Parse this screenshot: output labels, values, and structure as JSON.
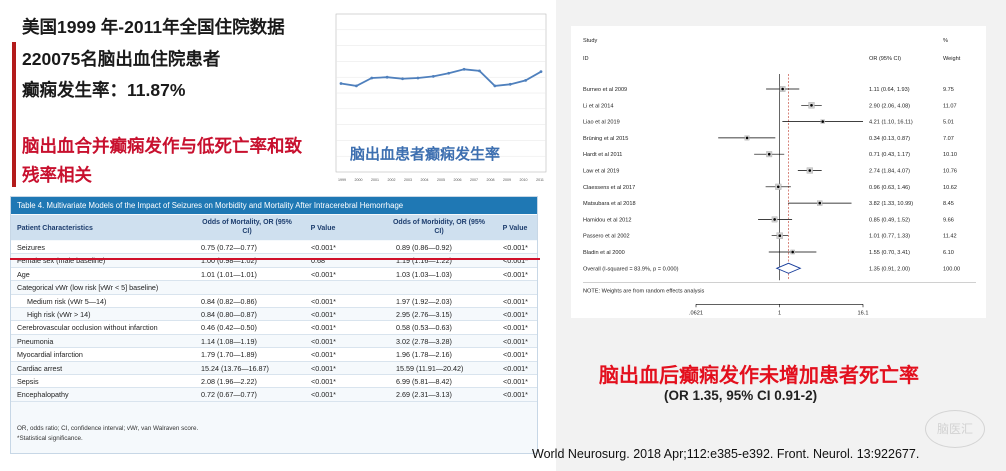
{
  "headline": {
    "line1": "美国1999 年-2011年全国住院数据",
    "line2": "220075名脑出血住院患者",
    "line3": "癫痫发生率：11.87%",
    "red1": "脑出血合并癫痫发作与低死亡率和致",
    "red2": "残率相关"
  },
  "chart_data": [
    {
      "type": "line",
      "caption": "脑出血患者癫痫发生率",
      "x": [
        "1999",
        "2000",
        "2001",
        "2002",
        "2003",
        "2004",
        "2005",
        "2006",
        "2007",
        "2008",
        "2009",
        "2010",
        "2011"
      ],
      "series": [
        {
          "values": [
            11.2,
            10.9,
            11.9,
            12.0,
            11.8,
            11.9,
            12.1,
            12.5,
            13.0,
            12.8,
            10.9,
            11.1,
            11.6,
            12.7
          ]
        }
      ],
      "ylim": [
        0,
        20
      ],
      "grid": true
    },
    {
      "type": "table",
      "title": "Table 4.  Multivariate Models of the Impact of Seizures on Morbidity and Mortality After Intracerebral Hemorrhage",
      "columns": [
        "Patient Characteristics",
        "Odds of Mortality, OR (95% CI)",
        "P Value",
        "Odds of Morbidity, OR (95% CI)",
        "P Value"
      ],
      "rows": [
        [
          "Seizures",
          "0.75 (0.72—0.77)",
          "<0.001*",
          "0.89 (0.86—0.92)",
          "<0.001*"
        ],
        [
          "Female sex (male baseline)",
          "1.00 (0.98—1.02)",
          "0.68",
          "1.19 (1.16—1.22)",
          "<0.001*"
        ],
        [
          "Age",
          "1.01 (1.01—1.01)",
          "<0.001*",
          "1.03 (1.03—1.03)",
          "<0.001*"
        ],
        [
          "Categorical vWr (low risk [vWr < 5] baseline)",
          "",
          "",
          "",
          ""
        ],
        [
          "Medium risk (vWr 5—14)",
          "0.84 (0.82—0.86)",
          "<0.001*",
          "1.97 (1.92—2.03)",
          "<0.001*"
        ],
        [
          "High risk (vWr > 14)",
          "0.84 (0.80—0.87)",
          "<0.001*",
          "2.95 (2.76—3.15)",
          "<0.001*"
        ],
        [
          "Cerebrovascular occlusion without infarction",
          "0.46 (0.42—0.50)",
          "<0.001*",
          "0.58 (0.53—0.63)",
          "<0.001*"
        ],
        [
          "Pneumonia",
          "1.14 (1.08—1.19)",
          "<0.001*",
          "3.02 (2.78—3.28)",
          "<0.001*"
        ],
        [
          "Myocardial infarction",
          "1.79 (1.70—1.89)",
          "<0.001*",
          "1.96 (1.78—2.16)",
          "<0.001*"
        ],
        [
          "Cardiac arrest",
          "15.24 (13.76—16.87)",
          "<0.001*",
          "15.59 (11.91—20.42)",
          "<0.001*"
        ],
        [
          "Sepsis",
          "2.08 (1.96—2.22)",
          "<0.001*",
          "6.99 (5.81—8.42)",
          "<0.001*"
        ],
        [
          "Encephalopathy",
          "0.72 (0.67—0.77)",
          "<0.001*",
          "2.69 (2.31—3.13)",
          "<0.001*"
        ]
      ],
      "footnotes": [
        "OR, odds ratio; CI, confidence interval; vWr, van Walraven score.",
        "*Statistical significance."
      ]
    },
    {
      "type": "scatter",
      "subtype": "forest",
      "header": {
        "study": "Study",
        "id": "ID",
        "or": "OR (95% CI)",
        "pct": "%",
        "weight": "Weight"
      },
      "studies": [
        {
          "name": "Burneo et al 2009",
          "or": 1.11,
          "lo": 0.64,
          "hi": 1.93,
          "label": "1.11 (0.64, 1.93)",
          "weight": "9.75"
        },
        {
          "name": "Li et al 2014",
          "or": 2.9,
          "lo": 2.06,
          "hi": 4.08,
          "label": "2.90 (2.06, 4.08)",
          "weight": "11.07"
        },
        {
          "name": "Liao et al 2019",
          "or": 4.21,
          "lo": 1.1,
          "hi": 16.11,
          "label": "4.21 (1.10, 16.11)",
          "weight": "5.01"
        },
        {
          "name": "Brüning et al 2015",
          "or": 0.34,
          "lo": 0.13,
          "hi": 0.87,
          "label": "0.34 (0.13, 0.87)",
          "weight": "7.07"
        },
        {
          "name": "Hardt et al 2011",
          "or": 0.71,
          "lo": 0.43,
          "hi": 1.17,
          "label": "0.71 (0.43, 1.17)",
          "weight": "10.10"
        },
        {
          "name": "Law et al 2019",
          "or": 2.74,
          "lo": 1.84,
          "hi": 4.07,
          "label": "2.74 (1.84, 4.07)",
          "weight": "10.76"
        },
        {
          "name": "Claessens et al 2017",
          "or": 0.96,
          "lo": 0.63,
          "hi": 1.46,
          "label": "0.96 (0.63, 1.46)",
          "weight": "10.62"
        },
        {
          "name": "Matsubara et al 2018",
          "or": 3.82,
          "lo": 1.33,
          "hi": 10.99,
          "label": "3.82 (1.33, 10.99)",
          "weight": "8.45"
        },
        {
          "name": "Hamidou et al 2012",
          "or": 0.85,
          "lo": 0.49,
          "hi": 1.52,
          "label": "0.85 (0.49, 1.52)",
          "weight": "9.66"
        },
        {
          "name": "Passero et al 2002",
          "or": 1.01,
          "lo": 0.77,
          "hi": 1.33,
          "label": "1.01 (0.77, 1.33)",
          "weight": "11.42"
        },
        {
          "name": "Bladin et al 2000",
          "or": 1.55,
          "lo": 0.7,
          "hi": 3.41,
          "label": "1.55 (0.70, 3.41)",
          "weight": "6.10"
        }
      ],
      "overall": {
        "name": "Overall  (I-squared = 83.9%, p = 0.000)",
        "or": 1.35,
        "lo": 0.91,
        "hi": 2.0,
        "label": "1.35 (0.91, 2.00)",
        "weight": "100.00"
      },
      "note": "NOTE: Weights are from random effects analysis",
      "xticks": [
        ".0621",
        "1",
        "16.1"
      ],
      "xlim": [
        0.0621,
        16.1
      ],
      "log_x": true
    }
  ],
  "conclusion": {
    "main": "脑出血后癫痫发作未增加患者死亡率",
    "stat": "(OR 1.35, 95% CI 0.91-2)"
  },
  "citation": "World Neurosurg. 2018 Apr;112:e385-e392. Front. Neurol. 13:922677.",
  "watermark": "脑医汇",
  "colors": {
    "accent_red": "#c8102e",
    "table_header": "#1f78b4",
    "chart_line": "#4f80bd"
  }
}
